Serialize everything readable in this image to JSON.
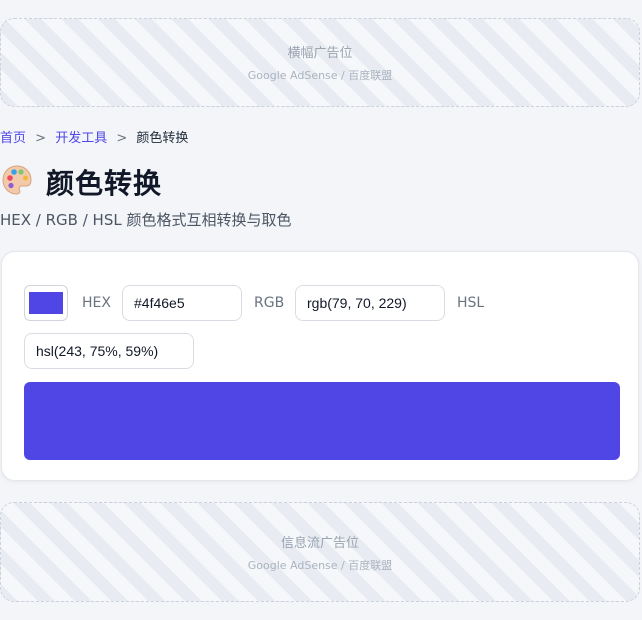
{
  "ads": {
    "top": {
      "title": "横幅广告位",
      "sub": "Google AdSense / 百度联盟"
    },
    "bottom": {
      "title": "信息流广告位",
      "sub": "Google AdSense / 百度联盟"
    }
  },
  "breadcrumb": {
    "items": [
      "首页",
      "开发工具",
      "颜色转换"
    ],
    "separator": ">"
  },
  "header": {
    "icon": "palette-icon",
    "title": "颜色转换",
    "subtitle": "HEX / RGB / HSL 颜色格式互相转换与取色"
  },
  "converter": {
    "color": "#4f46e5",
    "hex_label": "HEX",
    "hex_value": "#4f46e5",
    "rgb_label": "RGB",
    "rgb_value": "rgb(79, 70, 229)",
    "hsl_label": "HSL",
    "hsl_value": "hsl(243, 75%, 59%)"
  },
  "colors": {
    "accent": "#4f46e5",
    "page_bg": "#f3f5f9",
    "text": "#111827",
    "muted": "#6b7280"
  }
}
